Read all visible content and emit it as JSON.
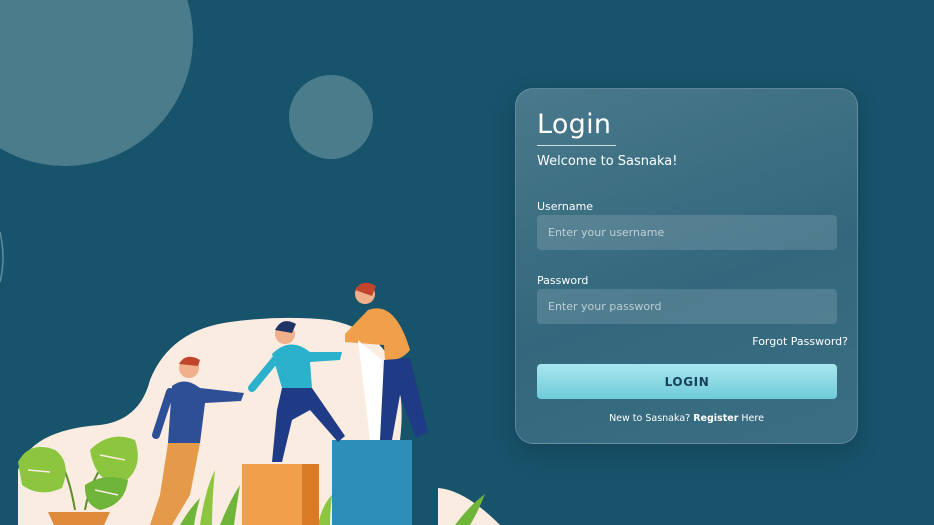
{
  "login": {
    "title": "Login",
    "welcome": "Welcome to Sasnaka!",
    "username_label": "Username",
    "username_placeholder": "Enter your username",
    "password_label": "Password",
    "password_placeholder": "Enter your password",
    "forgot_label": "Forgot Password?",
    "login_button": "LOGIN",
    "register_prefix": "New to Sasnaka?",
    "register_link": "Register",
    "register_suffix": "Here"
  },
  "colors": {
    "background": "#17536b",
    "card": "rgba(255,255,255,0.18)",
    "login_button": "#8fdbe6",
    "illustration_blob": "#fbece2"
  },
  "illustration": {
    "icons": [
      "decorative-circle",
      "team-climbing-illustration",
      "monstera-plant",
      "grass-leaves",
      "pedestal-boxes"
    ]
  }
}
